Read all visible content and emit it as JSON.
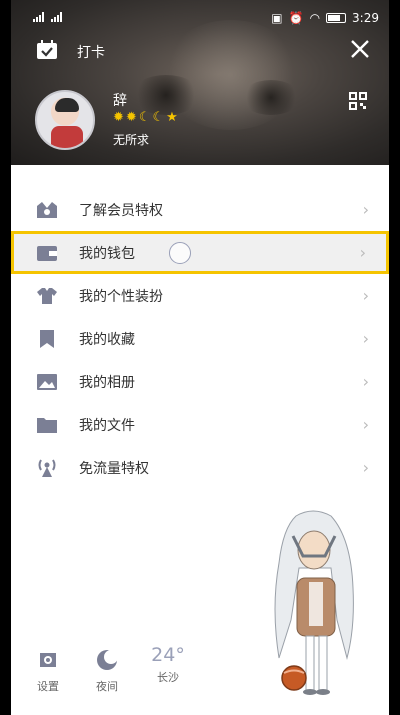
{
  "status_bar": {
    "time": "3:29"
  },
  "header": {
    "clock_in_label": "打卡",
    "username": "辞",
    "signature": "无所求",
    "level_badges": [
      "sun-icon",
      "sun-icon",
      "moon-icon",
      "moon-icon",
      "star-icon"
    ]
  },
  "menu": {
    "items": [
      {
        "label": "了解会员特权",
        "icon": "vip-crown-icon"
      },
      {
        "label": "我的钱包",
        "icon": "wallet-icon"
      },
      {
        "label": "我的个性装扮",
        "icon": "shirt-icon"
      },
      {
        "label": "我的收藏",
        "icon": "bookmark-icon"
      },
      {
        "label": "我的相册",
        "icon": "photo-icon"
      },
      {
        "label": "我的文件",
        "icon": "folder-icon"
      },
      {
        "label": "免流量特权",
        "icon": "antenna-icon"
      }
    ]
  },
  "bottom": {
    "settings_label": "设置",
    "night_label": "夜间",
    "temperature": "24°",
    "city": "长沙"
  },
  "colors": {
    "highlight": "#f5c400",
    "icon_gray": "#7b7f95"
  }
}
